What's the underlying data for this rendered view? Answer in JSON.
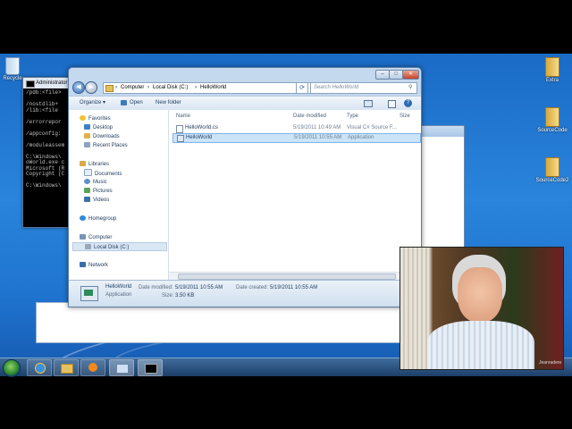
{
  "desktop": {
    "icons": [
      {
        "label": "Recycle",
        "icon": "recycle-bin-icon"
      },
      {
        "label": "Extra",
        "icon": "folder-icon"
      },
      {
        "label": "SourceCode",
        "icon": "folder-icon"
      },
      {
        "label": "SourceCode2",
        "icon": "folder-icon"
      }
    ]
  },
  "console": {
    "title": "Administrator",
    "lines": [
      "/pdb:<file>",
      "",
      "/nostdlib+",
      "/lib:<file",
      "",
      "/errorrepor",
      "",
      "/appconfig:",
      "",
      "/moduleassem",
      "",
      "C:\\Windows\\",
      "oWorld.exe c",
      "Microsoft (R",
      "Copyright (C",
      "",
      "C:\\Windows\\"
    ]
  },
  "explorer": {
    "breadcrumb": [
      "Computer",
      "Local Disk (C:)",
      "HelloWorld"
    ],
    "search_placeholder": "Search HelloWorld",
    "toolbar": {
      "organize": "Organize ▾",
      "open": "Open",
      "new_folder": "New folder"
    },
    "nav": {
      "favorites": "Favorites",
      "desktop": "Desktop",
      "downloads": "Downloads",
      "recent": "Recent Places",
      "libraries": "Libraries",
      "documents": "Documents",
      "music": "Music",
      "pictures": "Pictures",
      "videos": "Videos",
      "homegroup": "Homegroup",
      "computer": "Computer",
      "local_disk": "Local Disk (C:)",
      "network": "Network"
    },
    "columns": {
      "name": "Name",
      "date": "Date modified",
      "type": "Type",
      "size": "Size"
    },
    "files": [
      {
        "name": "HelloWorld.cs",
        "date": "5/19/2011 10:49 AM",
        "type": "Visual C# Source F...",
        "selected": false
      },
      {
        "name": "HelloWorld",
        "date": "5/19/2011 10:55 AM",
        "type": "Application",
        "selected": true
      }
    ],
    "details": {
      "name": "HelloWorld",
      "kind": "Application",
      "modified_label": "Date modified:",
      "modified": "5/19/2011 10:55 AM",
      "created_label": "Date created:",
      "created": "5/19/2011 10:55 AM",
      "size_label": "Size:",
      "size": "3.50 KB"
    }
  },
  "webcam": {
    "caption": "Jeanradere"
  },
  "colors": {
    "desktop": "#2a84db",
    "selection": "#cce4f7",
    "taskbar": "#1c3f68"
  }
}
